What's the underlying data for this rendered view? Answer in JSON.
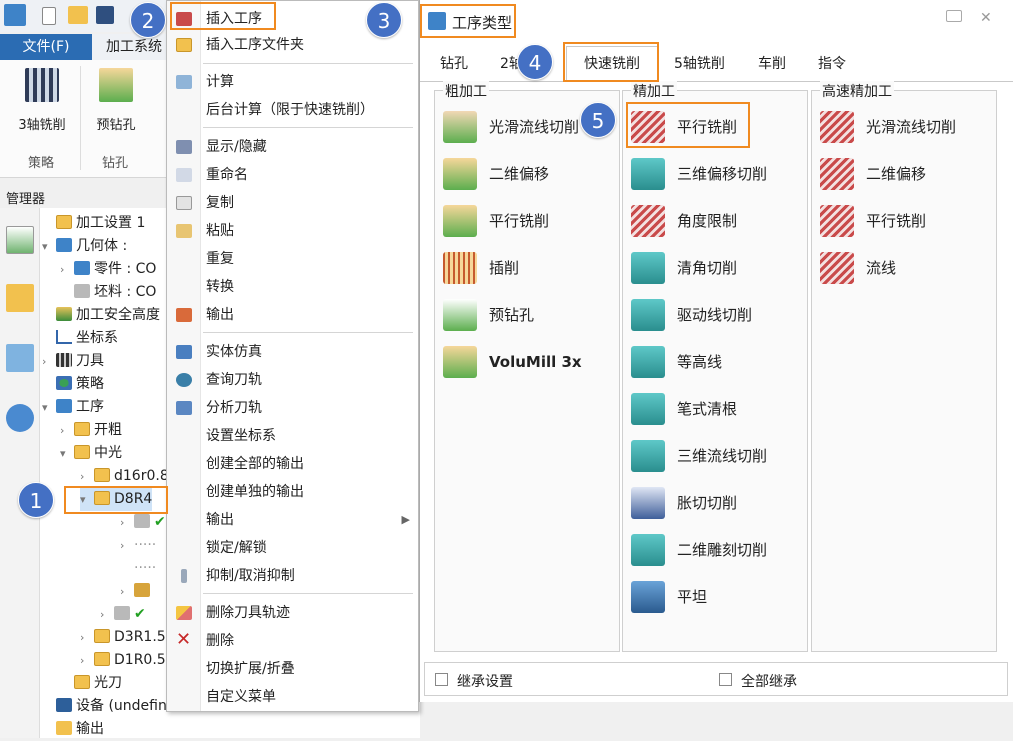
{
  "ribbon": {
    "file_tab": "文件(F)",
    "tab2": "加工系统",
    "btn_3axis": "3轴铣削",
    "btn_predrill": "预钻孔",
    "group_strategy": "策略",
    "group_drill": "钻孔"
  },
  "manager": {
    "title": "管理器"
  },
  "tree": [
    {
      "label": "加工设置 1",
      "indent": 0
    },
    {
      "label": "几何体 :",
      "indent": 0
    },
    {
      "label": "零件 : CO",
      "indent": 1
    },
    {
      "label": "坯料 : CO",
      "indent": 1
    },
    {
      "label": "加工安全高度",
      "indent": 0
    },
    {
      "label": "坐标系",
      "indent": 0
    },
    {
      "label": "刀具",
      "indent": 0
    },
    {
      "label": "策略",
      "indent": 0
    },
    {
      "label": "工序",
      "indent": 0
    },
    {
      "label": "开粗",
      "indent": 1
    },
    {
      "label": "中光",
      "indent": 1
    },
    {
      "label": "d16r0.8",
      "indent": 2
    },
    {
      "label": "D8R4",
      "indent": 2
    },
    {
      "label": "D3R1.5",
      "indent": 2
    },
    {
      "label": "D1R0.5",
      "indent": 2
    },
    {
      "label": "光刀",
      "indent": 1
    },
    {
      "label": "设备 (undefined)",
      "indent": 0
    },
    {
      "label": "输出",
      "indent": 0
    }
  ],
  "context_menu": {
    "items": [
      "插入工序",
      "插入工序文件夹",
      "计算",
      "后台计算（限于快速铣削）",
      "显示/隐藏",
      "重命名",
      "复制",
      "粘贴",
      "重复",
      "转换",
      "输出",
      "实体仿真",
      "查询刀轨",
      "分析刀轨",
      "设置坐标系",
      "创建全部的输出",
      "创建单独的输出",
      "输出",
      "锁定/解锁",
      "抑制/取消抑制",
      "删除刀具轨迹",
      "删除",
      "切换扩展/折叠",
      "自定义菜单"
    ]
  },
  "dialog": {
    "title": "工序类型",
    "tabs": [
      "钻孔",
      "2轴",
      "快速铣削",
      "5轴铣削",
      "车削",
      "指令"
    ],
    "rough": {
      "title": "粗加工",
      "items": [
        "光滑流线切削",
        "二维偏移",
        "平行铣削",
        "插削",
        "预钻孔",
        "VoluMill 3x"
      ]
    },
    "finish": {
      "title": "精加工",
      "items": [
        "平行铣削",
        "三维偏移切削",
        "角度限制",
        "清角切削",
        "驱动线切削",
        "等高线",
        "笔式清根",
        "三维流线切削",
        "胀切切削",
        "二维雕刻切削",
        "平坦"
      ]
    },
    "hsfinish": {
      "title": "高速精加工",
      "items": [
        "光滑流线切削",
        "二维偏移",
        "平行铣削",
        "流线"
      ]
    },
    "inherit_settings": "继承设置",
    "inherit_all": "全部继承"
  },
  "badges": [
    "1",
    "2",
    "3",
    "4",
    "5"
  ]
}
